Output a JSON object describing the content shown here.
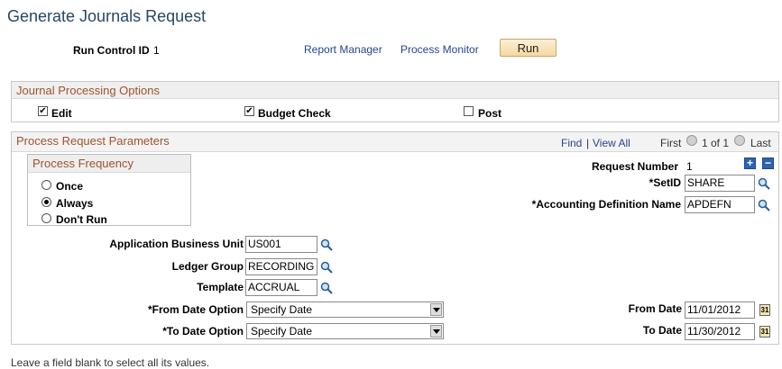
{
  "page": {
    "title": "Generate Journals Request"
  },
  "header": {
    "run_control_label": "Run Control ID",
    "run_control_value": "1",
    "report_manager": "Report Manager",
    "process_monitor": "Process Monitor",
    "run_label": "Run"
  },
  "journal_options": {
    "title": "Journal Processing Options",
    "edit": {
      "label": "Edit",
      "checked": true
    },
    "budget_check": {
      "label": "Budget Check",
      "checked": true
    },
    "post": {
      "label": "Post",
      "checked": false
    }
  },
  "params": {
    "title": "Process Request Parameters",
    "nav": {
      "find": "Find",
      "sep": "|",
      "view_all": "View All",
      "first": "First",
      "range": "1 of 1",
      "last": "Last"
    },
    "frequency": {
      "title": "Process Frequency",
      "options": [
        "Once",
        "Always",
        "Don't Run"
      ],
      "selected": "Always"
    },
    "request_number_label": "Request Number",
    "request_number_value": "1",
    "setid_label": "*SetID",
    "setid_value": "SHARE",
    "acct_def_label": "*Accounting Definition Name",
    "acct_def_value": "APDEFN",
    "abu_label": "Application Business Unit",
    "abu_value": "US001",
    "ledger_group_label": "Ledger Group",
    "ledger_group_value": "RECORDING",
    "template_label": "Template",
    "template_value": "ACCRUAL",
    "from_date_option_label": "*From Date Option",
    "from_date_option_value": "Specify Date",
    "to_date_option_label": "*To Date Option",
    "to_date_option_value": "Specify Date",
    "from_date_label": "From Date",
    "from_date_value": "11/01/2012",
    "to_date_label": "To Date",
    "to_date_value": "11/30/2012"
  },
  "footer": {
    "hint": "Leave a field blank to select all its values."
  },
  "colors": {
    "title": "#274766",
    "section_header": "#a0522d",
    "link": "#26468c",
    "run_button": "#f5d8a2"
  },
  "icons": [
    "lookup-icon",
    "calendar-icon",
    "add-row-icon",
    "delete-row-icon",
    "nav-previous-icon",
    "nav-next-icon",
    "checkbox-icon",
    "radio-icon",
    "dropdown-arrow-icon"
  ]
}
